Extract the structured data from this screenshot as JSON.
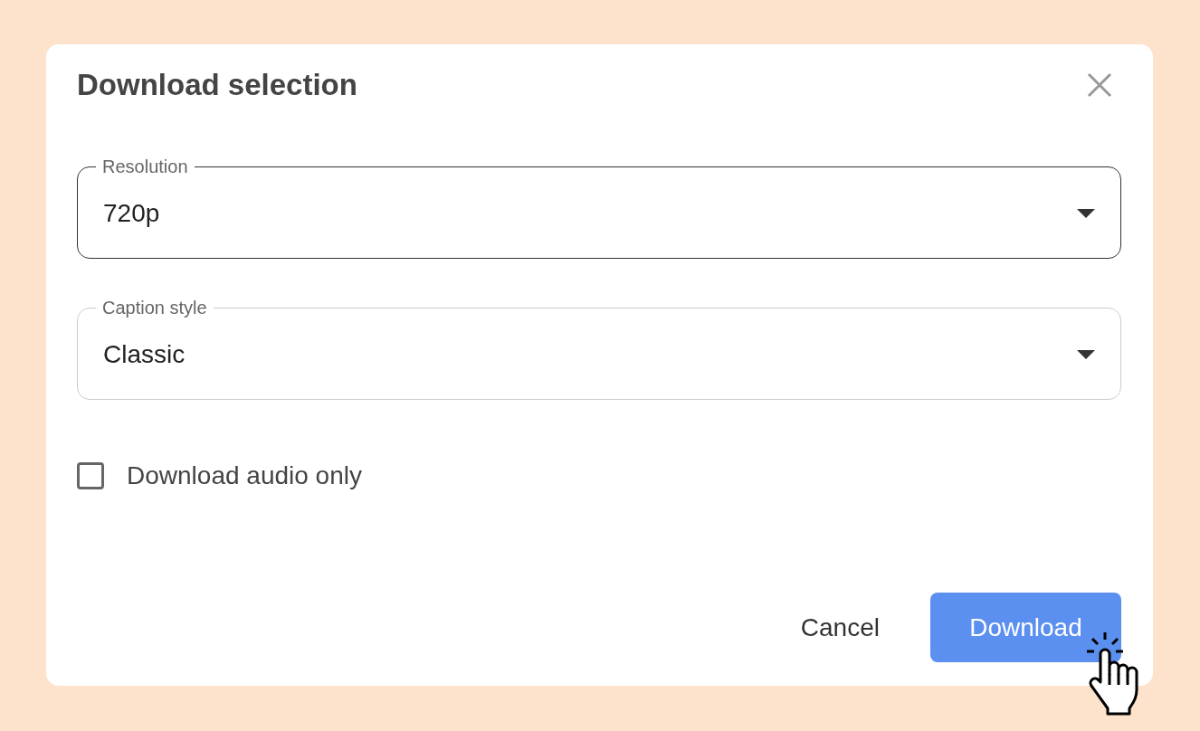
{
  "dialog": {
    "title": "Download selection"
  },
  "fields": [
    {
      "label": "Resolution",
      "value": "720p",
      "focused": true
    },
    {
      "label": "Caption style",
      "value": "Classic",
      "focused": false
    }
  ],
  "checkbox": {
    "label": "Download audio only",
    "checked": false
  },
  "buttons": [
    {
      "label": "Cancel",
      "kind": "text"
    },
    {
      "label": "Download",
      "kind": "primary"
    }
  ]
}
